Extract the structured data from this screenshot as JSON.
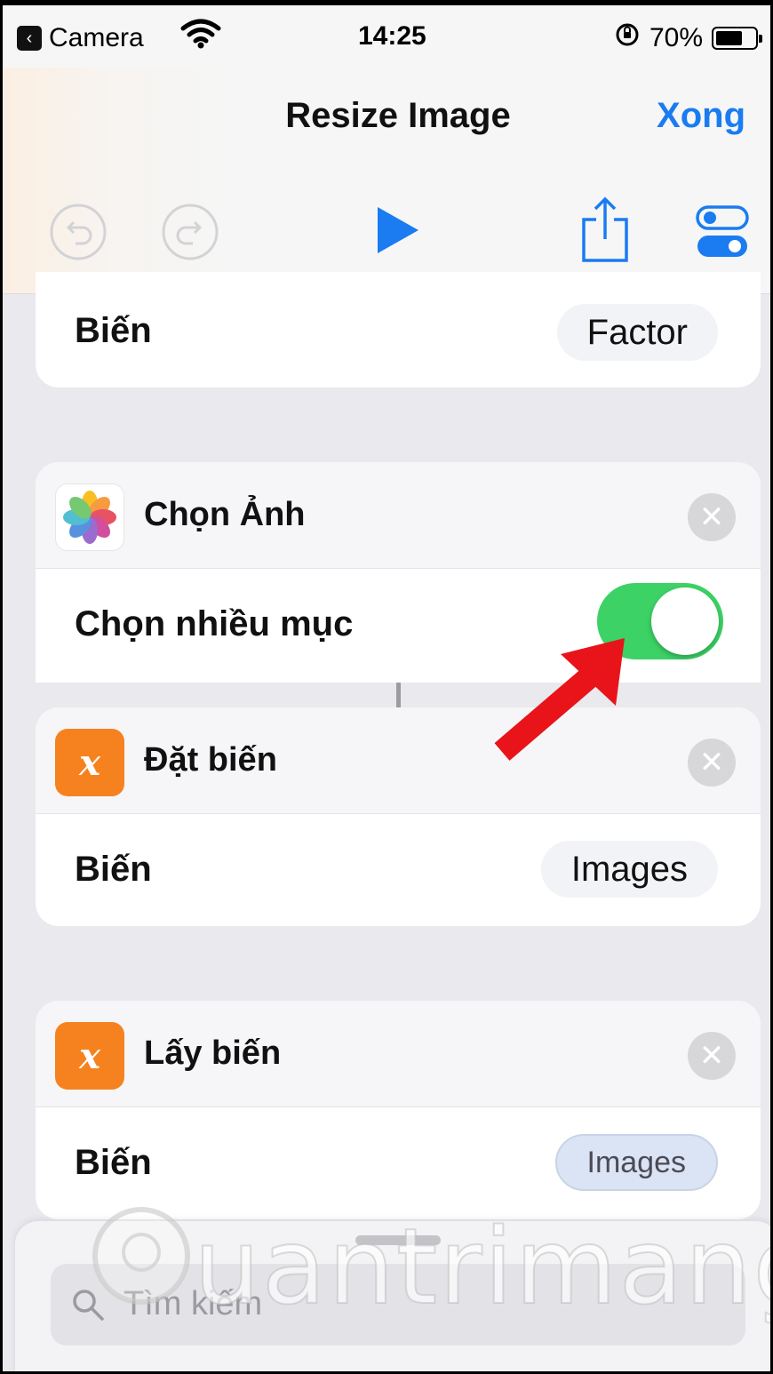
{
  "status_bar": {
    "back_label": "Camera",
    "time": "14:25",
    "battery": "70%",
    "battery_level": 0.7
  },
  "nav": {
    "title": "Resize Image",
    "done_label": "Xong"
  },
  "cards": {
    "top_var": {
      "row_label": "Biến",
      "value": "Factor"
    },
    "choose_photos": {
      "title": "Chọn Ảnh",
      "row_label": "Chọn nhiều mục",
      "toggle_on": true
    },
    "set_variable": {
      "title": "Đặt biến",
      "row_label": "Biến",
      "value": "Images",
      "icon_glyph": "x"
    },
    "get_variable": {
      "title": "Lấy biến",
      "row_label": "Biến",
      "value": "Images",
      "icon_glyph": "x"
    }
  },
  "search": {
    "placeholder": "Tìm kiếm"
  },
  "watermark": {
    "text": "uantrimang"
  },
  "colors": {
    "accent": "#1a7cf0",
    "toggle_on": "#3cd265",
    "variable_icon": "#f6821f",
    "annotation_arrow": "#e8141a"
  }
}
